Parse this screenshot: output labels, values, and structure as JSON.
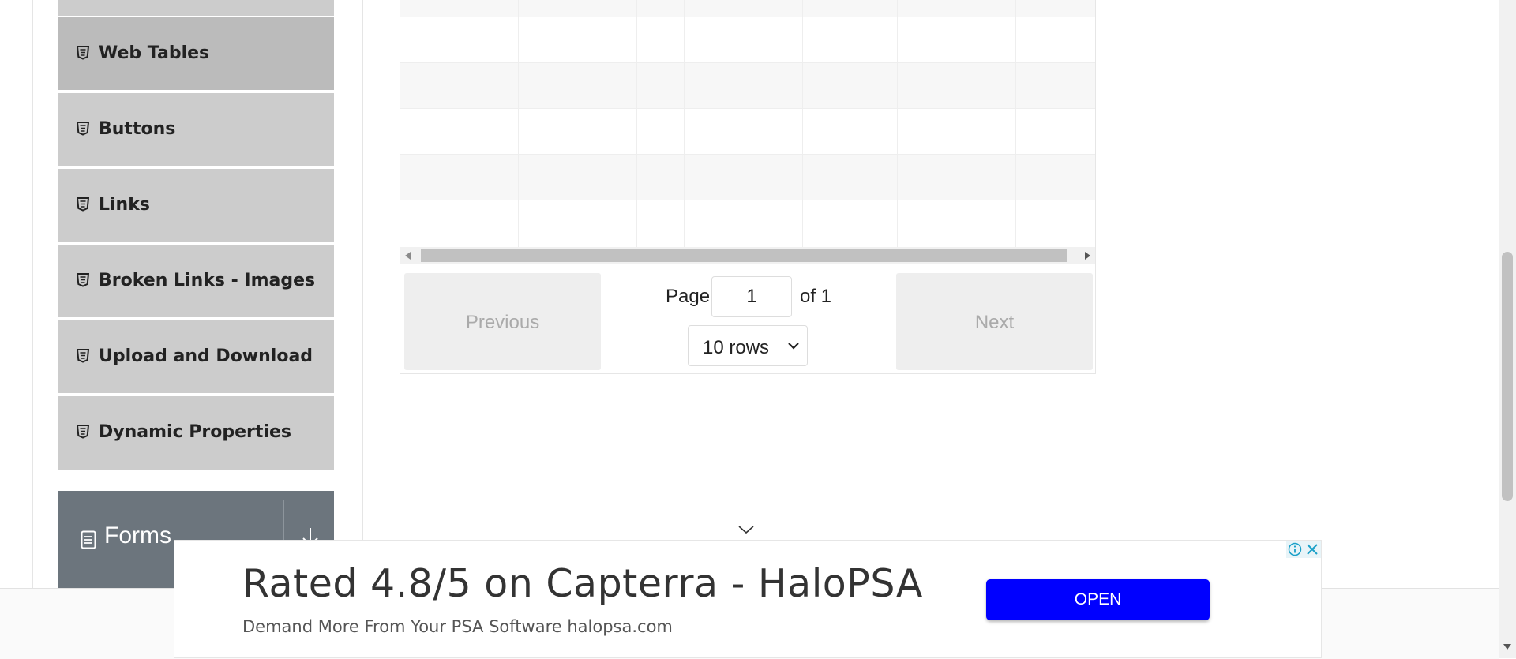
{
  "sidebar": {
    "items": [
      {
        "label": "Web Tables",
        "icon": "html5-icon",
        "active": true
      },
      {
        "label": "Buttons",
        "icon": "html5-icon"
      },
      {
        "label": "Links",
        "icon": "html5-icon"
      },
      {
        "label": "Broken Links - Images",
        "icon": "html5-icon"
      },
      {
        "label": "Upload and Download",
        "icon": "html5-icon"
      },
      {
        "label": "Dynamic Properties",
        "icon": "html5-icon"
      }
    ],
    "group": {
      "label": "Forms",
      "icon": "document-icon",
      "arrow_icon": "arrow-down-icon"
    }
  },
  "table": {
    "pagination": {
      "previous_label": "Previous",
      "next_label": "Next",
      "page_label": "Page",
      "page_value": "1",
      "of_label": "of 1",
      "rows_selected": "10 rows"
    }
  },
  "ad": {
    "title": "Rated 4.8/5 on Capterra - HaloPSA",
    "subtitle": "Demand More From Your PSA Software halopsa.com",
    "button_label": "OPEN",
    "accent_color": "#0000ff",
    "info_icon": "info-icon",
    "close_icon": "close-icon"
  }
}
